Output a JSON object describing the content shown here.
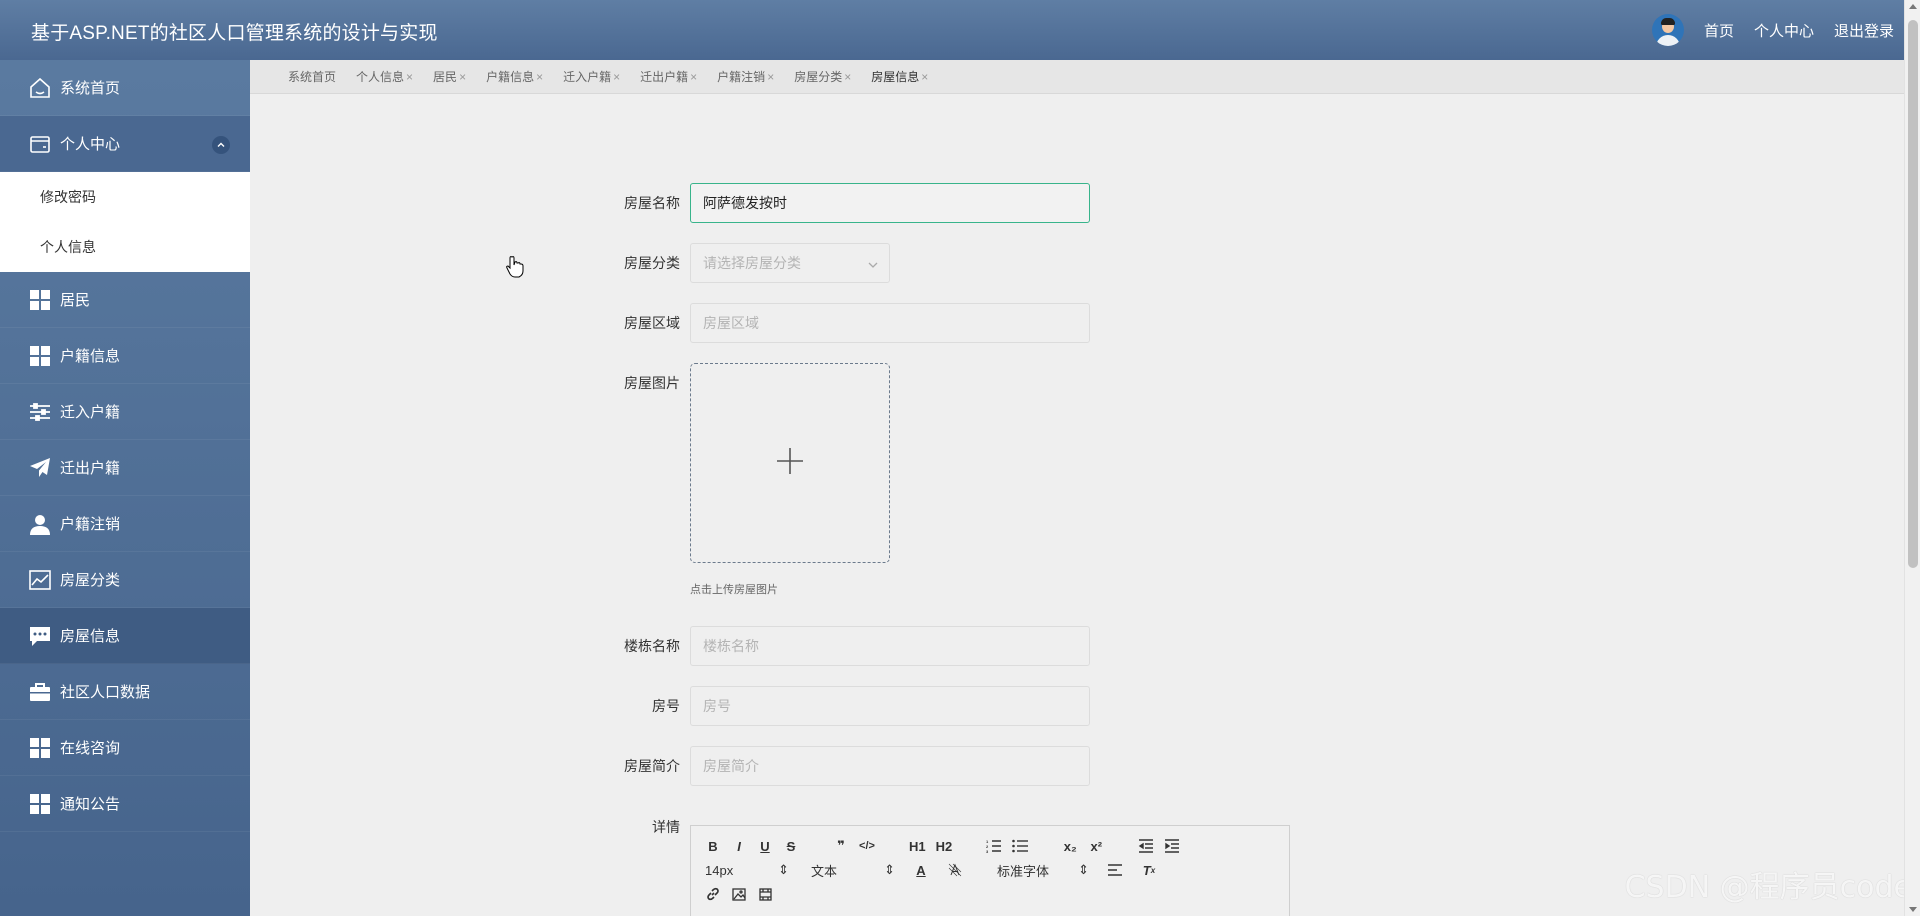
{
  "header": {
    "title": "基于ASP.NET的社区人口管理系统的设计与实现",
    "links": [
      "首页",
      "个人中心",
      "退出登录"
    ]
  },
  "sidebar": {
    "items": [
      {
        "label": "系统首页",
        "icon": "home-icon"
      },
      {
        "label": "个人中心",
        "icon": "wallet-icon",
        "expanded": true,
        "children": [
          {
            "label": "修改密码"
          },
          {
            "label": "个人信息"
          }
        ]
      },
      {
        "label": "居民",
        "icon": "grid-icon"
      },
      {
        "label": "户籍信息",
        "icon": "grid-icon"
      },
      {
        "label": "迁入户籍",
        "icon": "sliders-icon"
      },
      {
        "label": "迁出户籍",
        "icon": "paper-plane-icon"
      },
      {
        "label": "户籍注销",
        "icon": "user-icon"
      },
      {
        "label": "房屋分类",
        "icon": "chart-line-icon"
      },
      {
        "label": "房屋信息",
        "icon": "chat-bubble-icon",
        "active": true
      },
      {
        "label": "社区人口数据",
        "icon": "briefcase-icon"
      },
      {
        "label": "在线咨询",
        "icon": "grid-icon"
      },
      {
        "label": "通知公告",
        "icon": "grid-icon"
      }
    ]
  },
  "tabs": [
    {
      "label": "系统首页",
      "closable": false
    },
    {
      "label": "个人信息",
      "closable": true
    },
    {
      "label": "居民",
      "closable": true
    },
    {
      "label": "户籍信息",
      "closable": true
    },
    {
      "label": "迁入户籍",
      "closable": true
    },
    {
      "label": "迁出户籍",
      "closable": true
    },
    {
      "label": "户籍注销",
      "closable": true
    },
    {
      "label": "房屋分类",
      "closable": true
    },
    {
      "label": "房屋信息",
      "closable": true,
      "current": true
    }
  ],
  "tab_close_glyph": "×",
  "form": {
    "house_name": {
      "label": "房屋名称",
      "value": "阿萨德发按时"
    },
    "house_category": {
      "label": "房屋分类",
      "placeholder": "请选择房屋分类"
    },
    "house_area": {
      "label": "房屋区域",
      "placeholder": "房屋区域"
    },
    "house_image": {
      "label": "房屋图片",
      "hint": "点击上传房屋图片"
    },
    "building_name": {
      "label": "楼栋名称",
      "placeholder": "楼栋名称"
    },
    "room_number": {
      "label": "房号",
      "placeholder": "房号"
    },
    "house_intro": {
      "label": "房屋简介",
      "placeholder": "房屋简介"
    },
    "details": {
      "label": "详情"
    }
  },
  "editor": {
    "toolbar_row1": [
      "B",
      "I",
      "U",
      "S",
      "❞",
      "</>",
      "H1",
      "H2",
      "ol",
      "ul",
      "x₂",
      "x²",
      "outdent",
      "indent"
    ],
    "font_size": "14px",
    "text_style": "文本",
    "font_family": "标准字体"
  },
  "watermark": "CSDN @程序员code",
  "colors": {
    "header": "#52729a",
    "sidebar": "#5070a0",
    "active_item": "#3f5c83",
    "focus_border": "#38b48b",
    "background": "#efefef"
  }
}
